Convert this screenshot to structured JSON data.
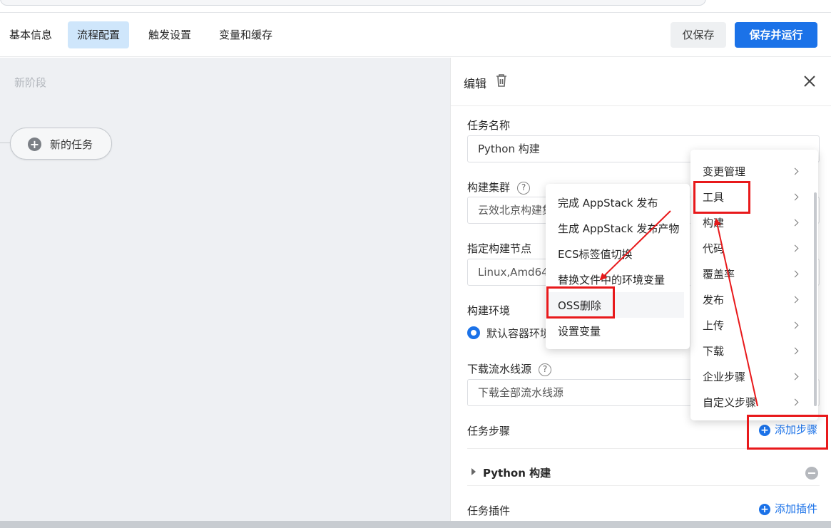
{
  "header": {
    "tabs": [
      {
        "label": "基本信息"
      },
      {
        "label": "流程配置",
        "active": true
      },
      {
        "label": "触发设置"
      },
      {
        "label": "变量和缓存"
      }
    ],
    "save_only": "仅保存",
    "save_run": "保存并运行"
  },
  "canvas": {
    "stage_title": "新阶段",
    "new_task": "新的任务"
  },
  "panel": {
    "title": "编辑",
    "task_name_label": "任务名称",
    "task_name_value": "Python 构建",
    "cluster_label": "构建集群",
    "cluster_value": "云效北京构建集",
    "node_label": "指定构建节点",
    "node_value": "Linux,Amd64",
    "env_label": "构建环境",
    "env_option": "默认容器环境",
    "source_label": "下载流水线源",
    "source_value": "下载全部流水线源",
    "steps_label": "任务步骤",
    "add_step": "添加步骤",
    "step_item": "Python 构建",
    "plugins_label": "任务插件",
    "add_plugin": "添加插件"
  },
  "menu_main": {
    "items": [
      "变更管理",
      "工具",
      "构建",
      "代码",
      "覆盖率",
      "发布",
      "上传",
      "下载",
      "企业步骤",
      "自定义步骤"
    ]
  },
  "menu_sub": {
    "items": [
      "完成 AppStack 发布",
      "生成 AppStack 发布产物",
      "ECS标签值切换",
      "替换文件中的环境变量",
      "OSS删除",
      "设置变量"
    ]
  },
  "colors": {
    "primary": "#1b72e8",
    "highlight": "#e8191b",
    "active_tab": "#cfe6fb"
  }
}
